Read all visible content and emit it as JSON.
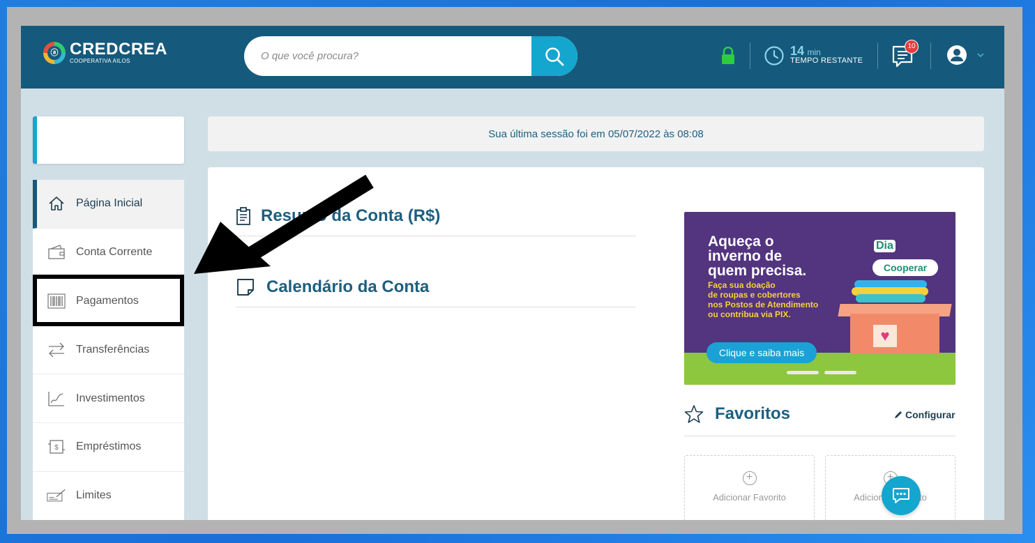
{
  "brand": {
    "name": "CREDCREA",
    "subtitle": "COOPERATIVA AILOS"
  },
  "search": {
    "placeholder": "O que você procura?"
  },
  "header": {
    "timer_value": "14",
    "timer_unit": "min",
    "timer_label": "TEMPO RESTANTE",
    "messages_badge": "10"
  },
  "sidebar": {
    "items": [
      {
        "label": "Página Inicial",
        "icon": "home-icon"
      },
      {
        "label": "Conta Corrente",
        "icon": "wallet-icon"
      },
      {
        "label": "Pagamentos",
        "icon": "barcode-icon"
      },
      {
        "label": "Transferências",
        "icon": "transfer-arrows-icon"
      },
      {
        "label": "Investimentos",
        "icon": "chart-line-icon"
      },
      {
        "label": "Empréstimos",
        "icon": "loan-icon"
      },
      {
        "label": "Limites",
        "icon": "check-sign-icon"
      }
    ]
  },
  "session": {
    "text": "Sua última sessão foi em 05/07/2022 às 08:08"
  },
  "sections": {
    "resumo_title": "Resumo da Conta (R$)",
    "calendario_title": "Calendário da Conta"
  },
  "banner": {
    "headline_lines": [
      "Aqueça o",
      "inverno de",
      "quem precisa."
    ],
    "body_lines": [
      "Faça sua doação",
      "de roupas e cobertores",
      "nos Postos de Atendimento",
      "ou contribua via PIX."
    ],
    "cta": "Clique e saiba mais",
    "logo_top": "Dia",
    "logo_bottom": "Cooperar"
  },
  "favorites": {
    "title": "Favoritos",
    "configure": "Configurar",
    "cards": [
      {
        "label": "Adicionar Favorito"
      },
      {
        "label": "Adicionar Favorito"
      }
    ]
  },
  "colors": {
    "header_bg": "#155a7c",
    "accent": "#14a6cf",
    "title_text": "#1d5f80",
    "lock_green": "#2ecc40",
    "badge_red": "#e63c3c"
  }
}
